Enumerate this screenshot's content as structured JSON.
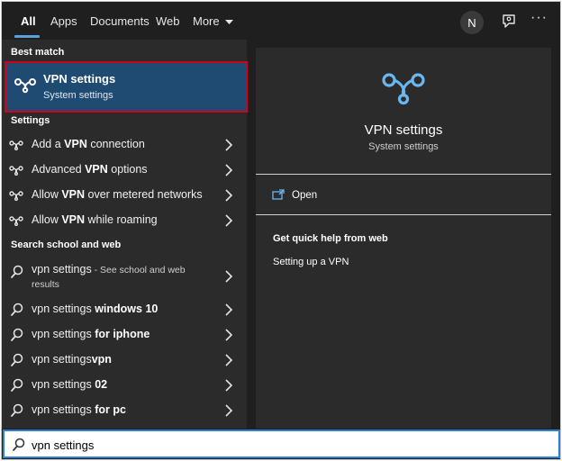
{
  "tabs": [
    {
      "label": "All",
      "active": true
    },
    {
      "label": "Apps"
    },
    {
      "label": "Documents"
    },
    {
      "label": "Web"
    },
    {
      "label": "More"
    }
  ],
  "header": {
    "avatar_initial": "N",
    "more_dots": "···"
  },
  "best_match": {
    "section_label": "Best match",
    "title": "VPN settings",
    "subtitle": "System settings",
    "icon": "vpn-icon"
  },
  "settings": {
    "section_label": "Settings",
    "items": [
      {
        "pre": "Add a ",
        "bold": "VPN",
        "post": " connection"
      },
      {
        "pre": "Advanced ",
        "bold": "VPN",
        "post": " options"
      },
      {
        "pre": "Allow ",
        "bold": "VPN",
        "post": " over metered networks"
      },
      {
        "pre": "Allow ",
        "bold": "VPN",
        "post": " while roaming"
      }
    ]
  },
  "web": {
    "section_label": "Search school and web",
    "first": {
      "text": "vpn settings",
      "suffix_line1": " - See school and web",
      "suffix_line2": "results"
    },
    "items": [
      {
        "pre": "vpn settings ",
        "bold": "windows 10"
      },
      {
        "pre": "vpn settings ",
        "bold": "for iphone"
      },
      {
        "pre": "vpn settings",
        "bold": "vpn"
      },
      {
        "pre": "vpn settings ",
        "bold": "02"
      },
      {
        "pre": "vpn settings ",
        "bold": "for pc"
      }
    ]
  },
  "preview": {
    "title": "VPN settings",
    "subtitle": "System settings",
    "open_label": "Open",
    "help_header": "Get quick help from web",
    "help_link": "Setting up a VPN"
  },
  "search": {
    "value": "vpn settings"
  },
  "colors": {
    "accent": "#5aa0e0",
    "selected": "#1f4b73",
    "highlight_border": "#d0021b",
    "search_border": "#2b7fd4"
  }
}
